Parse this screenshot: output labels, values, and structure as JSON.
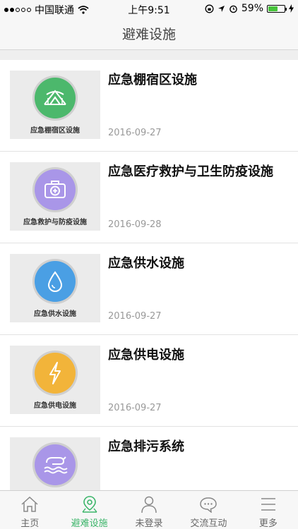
{
  "status_bar": {
    "carrier": "中国联通",
    "time": "上午9:51",
    "battery": "59%"
  },
  "header": {
    "title": "避难设施"
  },
  "items": [
    {
      "thumb_label": "应急棚宿区设施",
      "title": "应急棚宿区设施",
      "date": "2016-09-27",
      "icon": "tent-icon",
      "color": "#4cb86c"
    },
    {
      "thumb_label": "应急救护与防疫设施",
      "title": "应急医疗救护与卫生防疫设施",
      "date": "2016-09-28",
      "icon": "medical-kit-icon",
      "color": "#a996e8"
    },
    {
      "thumb_label": "应急供水设施",
      "title": "应急供水设施",
      "date": "2016-09-27",
      "icon": "water-drop-icon",
      "color": "#4a9fe4"
    },
    {
      "thumb_label": "应急供电设施",
      "title": "应急供电设施",
      "date": "2016-09-27",
      "icon": "lightning-icon",
      "color": "#f2b43a"
    },
    {
      "thumb_label": "",
      "title": "应急排污系统",
      "date": "",
      "icon": "sewage-icon",
      "color": "#a996e8"
    }
  ],
  "tabs": [
    {
      "label": "主页",
      "icon": "home-icon"
    },
    {
      "label": "避难设施",
      "icon": "location-pin-icon"
    },
    {
      "label": "未登录",
      "icon": "user-icon"
    },
    {
      "label": "交流互动",
      "icon": "chat-icon"
    },
    {
      "label": "更多",
      "icon": "menu-icon"
    }
  ],
  "active_tab_color": "#3cb56a"
}
